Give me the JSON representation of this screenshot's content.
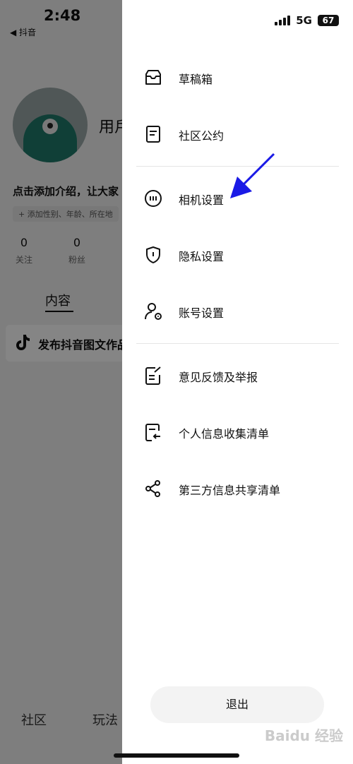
{
  "status_bar": {
    "time": "2:48",
    "back_app": "◀ 抖音",
    "network": "5G",
    "battery": "67"
  },
  "profile": {
    "name_partial": "用戶",
    "bio": "点击添加介绍，让大家",
    "tag_hint": "+ 添加性别、年龄、所在地",
    "stats": [
      {
        "count": "0",
        "label": "关注"
      },
      {
        "count": "0",
        "label": "粉丝"
      }
    ],
    "tab": "内容",
    "publish_text": "发布抖音图文作品"
  },
  "bottom_nav": [
    "社区",
    "玩法"
  ],
  "drawer": {
    "menu": [
      {
        "label": "草稿箱",
        "icon": "inbox-icon"
      },
      {
        "label": "社区公约",
        "icon": "document-icon"
      },
      {
        "label": "相机设置",
        "icon": "camera-settings-icon"
      },
      {
        "label": "隐私设置",
        "icon": "shield-icon"
      },
      {
        "label": "账号设置",
        "icon": "user-settings-icon"
      },
      {
        "label": "意见反馈及举报",
        "icon": "feedback-icon"
      },
      {
        "label": "个人信息收集清单",
        "icon": "info-list-icon"
      },
      {
        "label": "第三方信息共享清单",
        "icon": "share-icon"
      }
    ],
    "logout": "退出"
  },
  "watermark": "Baidu 经验",
  "colors": {
    "arrow": "#1a1ae6",
    "drawer_bg": "#ffffff",
    "overlay": "#000000"
  }
}
